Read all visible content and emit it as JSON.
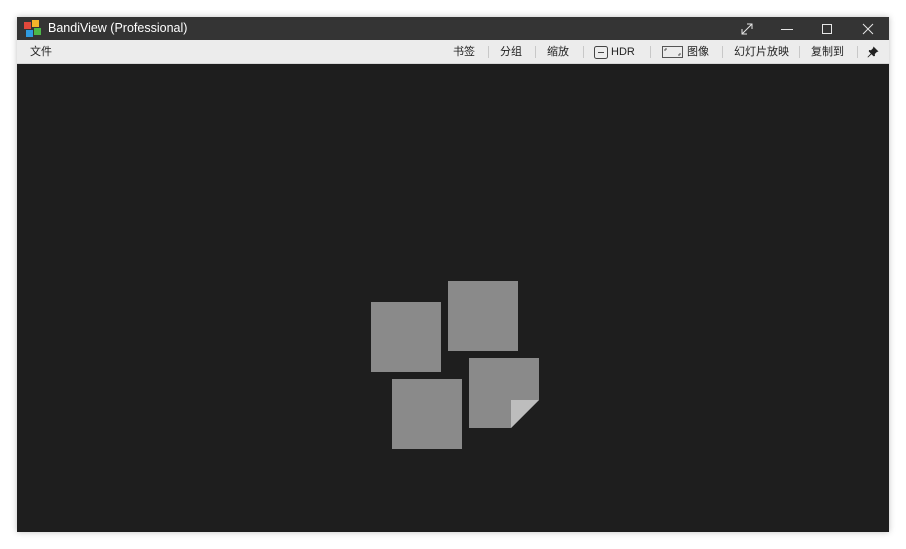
{
  "window": {
    "title": "BandiView (Professional)"
  },
  "icons": {
    "app": "bandiview-logo-icon",
    "fullscreen": "expand-arrows-icon",
    "minimize": "minimize-icon",
    "maximize": "maximize-icon",
    "close": "close-icon",
    "hdr": "hdr-toggle-icon",
    "image": "image-frame-icon",
    "pin": "pin-icon",
    "placeholder": "empty-gallery-icon"
  },
  "colors": {
    "titlebar": "#343434",
    "menubar": "#ececec",
    "viewer_bg": "#1e1e1e",
    "placeholder_tile": "#8a8a8a"
  },
  "menubar": {
    "file": "文件"
  },
  "toolbar": {
    "bookmark": "书签",
    "group": "分组",
    "zoom": "缩放",
    "hdr": "HDR",
    "image": "图像",
    "slideshow": "幻灯片放映",
    "copy_to": "复制到"
  }
}
